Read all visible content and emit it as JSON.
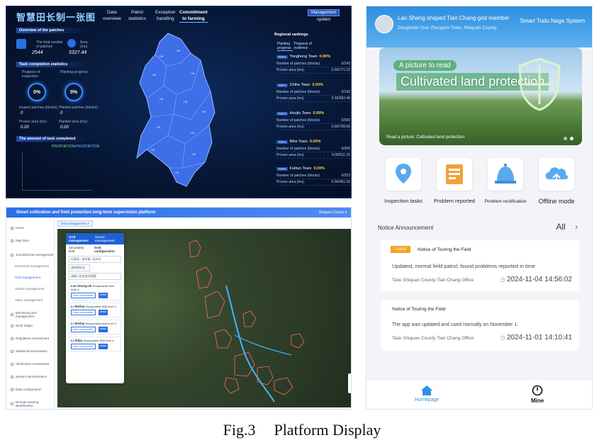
{
  "dashboard": {
    "brand": "智慧田长制一张图",
    "nav": [
      {
        "l1": "Data",
        "l2": "overview"
      },
      {
        "l1": "Patrol",
        "l2": "statistics"
      },
      {
        "l1": "Exception",
        "l2": "handling"
      },
      {
        "l1": "Commitment",
        "l2": "to farming"
      }
    ],
    "management_btn": "Management",
    "management_sub": "system",
    "overview": {
      "title": "Overview of the patches",
      "total_label": "The total number of patches",
      "total_value": "2544",
      "area_label": "Area (mu)",
      "area_value": "5327.44"
    },
    "task": {
      "title": "Task completion statistics",
      "progress_label": "Progress of Inspection",
      "progress_value": "0%",
      "planting_label": "Planting progress",
      "planting_value": "0%",
      "inspect_patch_label": "Inspect patches (blocks)",
      "inspect_patch_value": "0",
      "plant_patch_label": "Planted patches (blocks)",
      "plant_patch_value": "0",
      "p_area_label": "Proven area (mu)",
      "p_area_value": "0.00",
      "pl_area_label": "Planted area (mu)",
      "pl_area_value": "0.00"
    },
    "amount_title": "The amount of task completed",
    "legend": [
      "PROPORTION",
      "PROPORTION"
    ],
    "ranking": {
      "title": "Regional rankings",
      "tabs": [
        "Planting progress",
        "Progress of evidence"
      ],
      "towns": [
        {
          "tag": "TOP1",
          "name": "Yonghong Town",
          "pct": "0.00%",
          "r1l": "Number of patches (blocks)",
          "r1v": "0/143",
          "r2l": "Proven area (mu)",
          "r2v": "0.00/171.02"
        },
        {
          "tag": "TOP2",
          "name": "Chihe Town",
          "pct": "0.00%",
          "r1l": "Number of patches (blocks)",
          "r1v": "0/142",
          "r2l": "Proven area (mu)",
          "r2v": "0.00/652.48"
        },
        {
          "tag": "TOP3",
          "name": "Houliu Town",
          "pct": "0.00%",
          "r1l": "Number of patches (blocks)",
          "r1v": "0/300",
          "r2l": "Proven area (mu)",
          "r2v": "0.00/708.66"
        },
        {
          "tag": "TOP4",
          "name": "Bihe Town",
          "pct": "0.00%",
          "r1l": "Number of patches (blocks)",
          "r1v": "0/306",
          "r2l": "Proven area (mu)",
          "r2v": "0.00/511.20"
        },
        {
          "tag": "TOP5",
          "name": "Fulitun Town",
          "pct": "0.00%",
          "r1l": "Number of patches (blocks)",
          "r1v": "0/253",
          "r2l": "Proven area (mu)",
          "r2v": "0.00/461.56"
        }
      ]
    },
    "map_labels": [
      "HE",
      "HE",
      "HE",
      "HE",
      "HE",
      "HE",
      "HE",
      "HE",
      "HE",
      "HE",
      "HE",
      "HE"
    ]
  },
  "web": {
    "title": "Smart cultivation and field protection long-term supervision platform",
    "user": "Shiquan County ▾",
    "sidebar": [
      {
        "label": "Home",
        "sub": false
      },
      {
        "label": "Map farm",
        "sub": false
      },
      {
        "label": "Jurisdictional management",
        "sub": false
      },
      {
        "label": "Personnel management",
        "sub": true
      },
      {
        "label": "Grid management",
        "sub": true,
        "active": true
      },
      {
        "label": "Station management",
        "sub": true
      },
      {
        "label": "Video management",
        "sub": true
      },
      {
        "label": "Monitoring and management",
        "sub": false
      },
      {
        "label": "Work ledger",
        "sub": false
      },
      {
        "label": "Regulatory assessment",
        "sub": false
      },
      {
        "label": "Statistical examination",
        "sub": false
      },
      {
        "label": "Verification Assessment",
        "sub": false
      },
      {
        "label": "System administration",
        "sub": false
      },
      {
        "label": "Data configuration",
        "sub": false
      },
      {
        "label": "Remote sensing identification",
        "sub": false
      }
    ],
    "crumb": "Grid management ×",
    "drawer": {
      "tab1": "Grid management",
      "tab2": "Sector management",
      "tab_a": "Secondary field",
      "tab_b": "Grid configuration",
      "f1": "石泉县 / 池河镇 / 迎丰村",
      "f2": "请选择田长",
      "f3": "请输入田长姓名搜索",
      "cards": [
        {
          "name": "Lee Seung-ok",
          "role": "Responsible field level 4",
          "b1": "View responsible",
          "b2": "detail"
        },
        {
          "name": "Li Weihai",
          "role": "Responsible field level 4",
          "b1": "View responsible",
          "b2": "detail"
        },
        {
          "name": "Li Weihai",
          "role": "Responsible field level 4",
          "b1": "View responsible",
          "b2": "detail"
        },
        {
          "name": "Li Shiju",
          "role": "Responsible field level 4",
          "b1": "View responsible",
          "b2": "detail"
        }
      ]
    }
  },
  "mobile": {
    "user_name": "Lao Sheng shaped Tian Chang grid member",
    "user_addr": "Donghuter Gun Zhongshi Town, Shiquan County",
    "system": "Smart Tudu Naga System",
    "banner_small": "A picture to read",
    "banner_big": "Cultivated land protection",
    "banner_caption": "Read a picture: Cultivated land protection",
    "quick": [
      "Inspection tasks",
      "Problem reported",
      "Problem rectification",
      "Offline mode"
    ],
    "notice_title": "Notice Announcement",
    "all": "All",
    "notices": [
      {
        "badge": "Latest",
        "title": "Notice of Touring the Field",
        "text": "Updated, normal field patrol, found problems reported in time",
        "office": "Task Shiquan County Tian Chang Office",
        "time": "2024-11-04 14:56:02"
      },
      {
        "title": "Notice of Touring the Field",
        "text": "The app was updated and used normally on November 1.",
        "office": "Task Shiquan County Tian Chang Office",
        "time": "2024-11-01 14:10:41"
      }
    ],
    "tabs": [
      "Homepage",
      "Mine"
    ]
  },
  "caption": {
    "fig": "Fig.3",
    "text": "Platform Display"
  }
}
